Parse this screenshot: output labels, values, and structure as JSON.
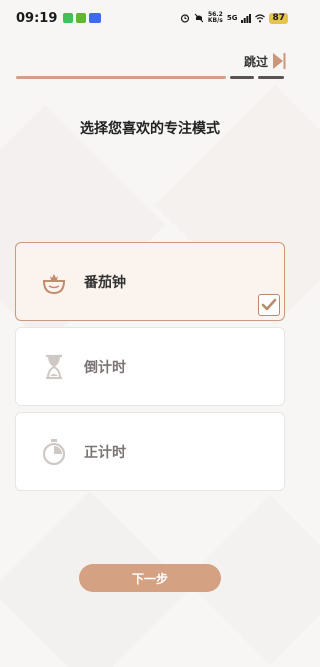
{
  "status_bar": {
    "time": "09:19",
    "net_speed_value": "56.2",
    "net_speed_unit": "KB/s",
    "network": "5G",
    "battery": "87"
  },
  "header": {
    "skip_label": "跳过",
    "progress": {
      "current_step": 1,
      "total_steps": 3
    }
  },
  "title": "选择您喜欢的专注模式",
  "modes": [
    {
      "label": "番茄钟",
      "icon": "tomato-icon",
      "selected": true
    },
    {
      "label": "倒计时",
      "icon": "hourglass-icon",
      "selected": false
    },
    {
      "label": "正计时",
      "icon": "stopwatch-icon",
      "selected": false
    }
  ],
  "next_label": "下一步",
  "colors": {
    "accent": "#d4a283",
    "accent_border": "#c99a7d",
    "selected_bg": "#faf3ee",
    "progress_inactive": "#5c5452"
  }
}
